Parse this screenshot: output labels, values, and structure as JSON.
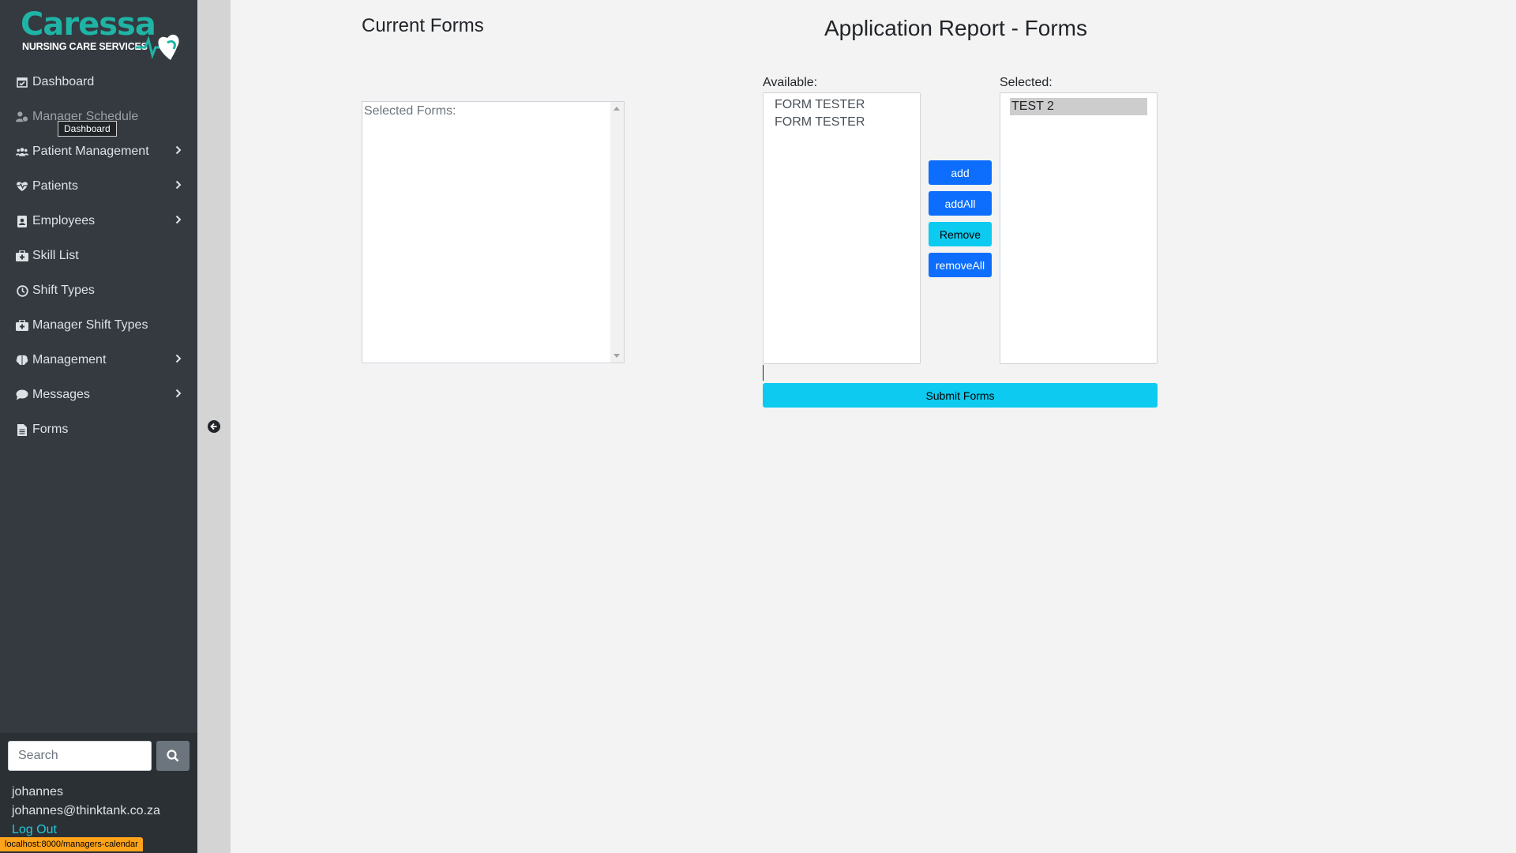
{
  "brand": {
    "name": "Caressa",
    "tagline": "NURSING CARE SERVICES",
    "primary_color": "#1fb4a6"
  },
  "sidebar": {
    "items": [
      {
        "label": "Dashboard",
        "icon": "calendar-check-icon",
        "has_submenu": false
      },
      {
        "label": "Manager Schedule",
        "icon": "user-clock-icon",
        "has_submenu": false
      },
      {
        "label": "Patient Management",
        "icon": "users-icon",
        "has_submenu": true
      },
      {
        "label": "Patients",
        "icon": "heart-pulse-icon",
        "has_submenu": true
      },
      {
        "label": "Employees",
        "icon": "id-badge-icon",
        "has_submenu": true
      },
      {
        "label": "Skill List",
        "icon": "medkit-icon",
        "has_submenu": false
      },
      {
        "label": "Shift Types",
        "icon": "clock-icon",
        "has_submenu": false
      },
      {
        "label": "Manager Shift Types",
        "icon": "medkit-icon",
        "has_submenu": false
      },
      {
        "label": "Management",
        "icon": "brain-icon",
        "has_submenu": true
      },
      {
        "label": "Messages",
        "icon": "comment-icon",
        "has_submenu": true
      },
      {
        "label": "Forms",
        "icon": "file-icon",
        "has_submenu": false
      }
    ],
    "tooltip": "Dashboard",
    "search": {
      "placeholder": "Search",
      "value": ""
    },
    "user": {
      "name": "johannes",
      "email": "johannes@thinktank.co.za",
      "logout_label": "Log Out"
    }
  },
  "status_bar": {
    "url": "localhost:8000/managers-calendar"
  },
  "current_forms": {
    "title": "Current Forms",
    "placeholder": "Selected Forms:"
  },
  "report": {
    "title": "Application Report - Forms",
    "available_label": "Available:",
    "selected_label": "Selected:",
    "available_options": [
      "FORM TESTER",
      "FORM TESTER"
    ],
    "selected_options": [
      "TEST 2"
    ],
    "buttons": {
      "add": "add",
      "add_all": "addAll",
      "remove": "Remove",
      "remove_all": "removeAll",
      "submit": "Submit Forms"
    }
  }
}
